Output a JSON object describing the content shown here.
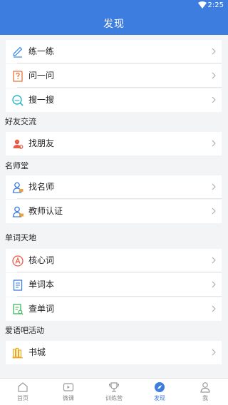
{
  "status": {
    "time": "2:25"
  },
  "header": {
    "title": "发现"
  },
  "items": {
    "practice": "练一练",
    "ask": "问一问",
    "search": "搜一搜",
    "find_friends": "找朋友",
    "find_teacher": "找名师",
    "teacher_cert": "教师认证",
    "core_words": "核心词",
    "word_book": "单词本",
    "lookup_word": "查单词",
    "bookstore": "书城"
  },
  "sections": {
    "friends": "好友交流",
    "teachers": "名师堂",
    "words": "单词天地",
    "activities": "爱语吧活动"
  },
  "tabs": {
    "home": "首页",
    "lessons": "微课",
    "training": "训练营",
    "discover": "发现",
    "me": "我"
  },
  "colors": {
    "brand": "#3d7de0"
  }
}
